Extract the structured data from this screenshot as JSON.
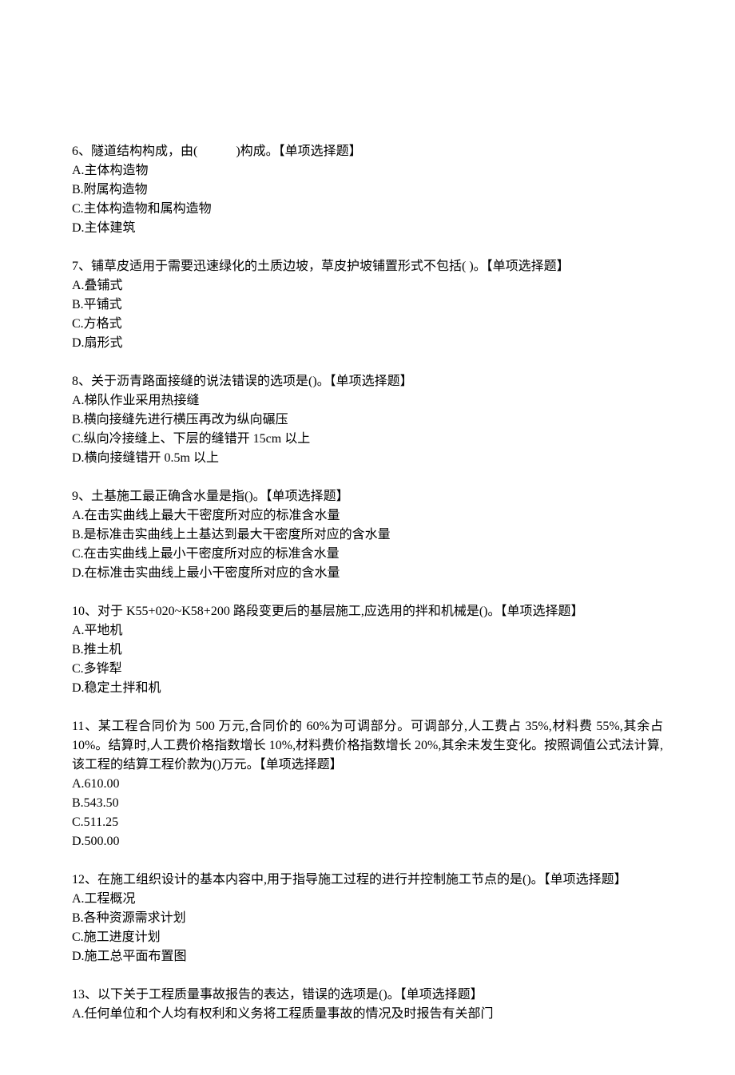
{
  "questions": [
    {
      "stem": "6、隧道结构构成，由(　　　)构成。【单项选择题】",
      "options": [
        "A.主体构造物",
        "B.附属构造物",
        "C.主体构造物和属构造物",
        "D.主体建筑"
      ]
    },
    {
      "stem": "7、铺草皮适用于需要迅速绿化的土质边坡，草皮护坡铺置形式不包括( )。【单项选择题】",
      "options": [
        "A.叠铺式",
        "B.平铺式",
        "C.方格式",
        "D.扇形式"
      ]
    },
    {
      "stem": "8、关于沥青路面接缝的说法错误的选项是()。【单项选择题】",
      "options": [
        "A.梯队作业采用热接缝",
        "B.横向接缝先进行横压再改为纵向碾压",
        "C.纵向冷接缝上、下层的缝错开 15cm 以上",
        "D.横向接缝错开 0.5m 以上"
      ]
    },
    {
      "stem": "9、土基施工最正确含水量是指()。【单项选择题】",
      "options": [
        "A.在击实曲线上最大干密度所对应的标准含水量",
        "B.是标准击实曲线上土基达到最大干密度所对应的含水量",
        "C.在击实曲线上最小干密度所对应的标准含水量",
        "D.在标准击实曲线上最小干密度所对应的含水量"
      ]
    },
    {
      "stem": "10、对于 K55+020~K58+200 路段变更后的基层施工,应选用的拌和机械是()。【单项选择题】",
      "options": [
        "A.平地机",
        "B.推土机",
        "C.多铧犁",
        "D.稳定土拌和机"
      ]
    },
    {
      "stem": "11、某工程合同价为 500 万元,合同价的 60%为可调部分。可调部分,人工费占 35%,材料费 55%,其余占 10%。结算时,人工费价格指数增长 10%,材料费价格指数增长 20%,其余未发生变化。按照调值公式法计算,该工程的结算工程价款为()万元。【单项选择题】",
      "options": [
        "A.610.00",
        "B.543.50",
        "C.511.25",
        "D.500.00"
      ]
    },
    {
      "stem": "12、在施工组织设计的基本内容中,用于指导施工过程的进行并控制施工节点的是()。【单项选择题】",
      "options": [
        "A.工程概况",
        "B.各种资源需求计划",
        "C.施工进度计划",
        "D.施工总平面布置图"
      ]
    },
    {
      "stem": "13、以下关于工程质量事故报告的表达，错误的选项是()。【单项选择题】",
      "options": [
        "A.任何单位和个人均有权利和义务将工程质量事故的情况及时报告有关部门"
      ]
    }
  ]
}
